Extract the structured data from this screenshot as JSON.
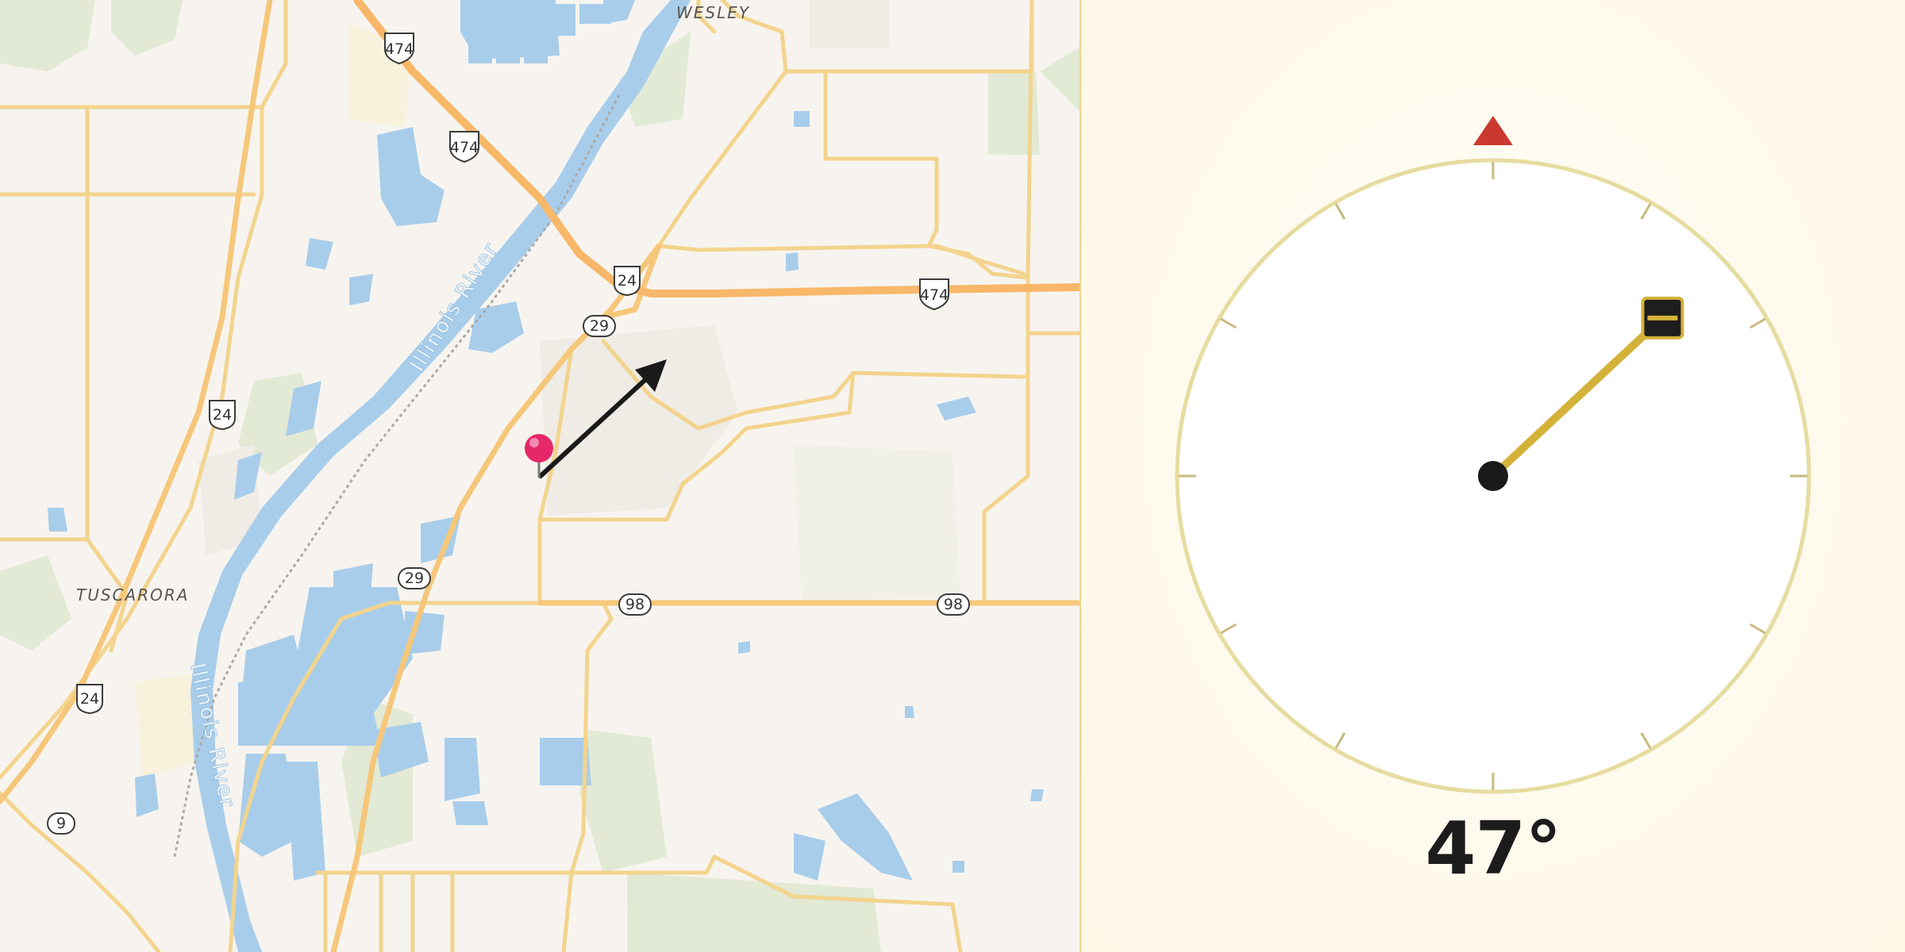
{
  "map": {
    "towns": [
      "WESLEY",
      "TUSCARORA"
    ],
    "river_label": "Illinois River",
    "route_badges": {
      "interstate_474": "474",
      "us_24": "24",
      "state_29": "29",
      "state_98": "98",
      "state_9": "9"
    },
    "colors": {
      "land": "#f7f4ef",
      "water": "#a8cdea",
      "major_road": "#f8c47c",
      "minor_road": "#f3d48d",
      "park": "#dfe8d2",
      "pin": "#e6286a"
    }
  },
  "compass": {
    "heading_deg": 47,
    "heading_text": "47°",
    "north_marker_color": "#c9392f",
    "needle_color": "#d4b23a",
    "dial_ring_color": "#e6dca0"
  }
}
